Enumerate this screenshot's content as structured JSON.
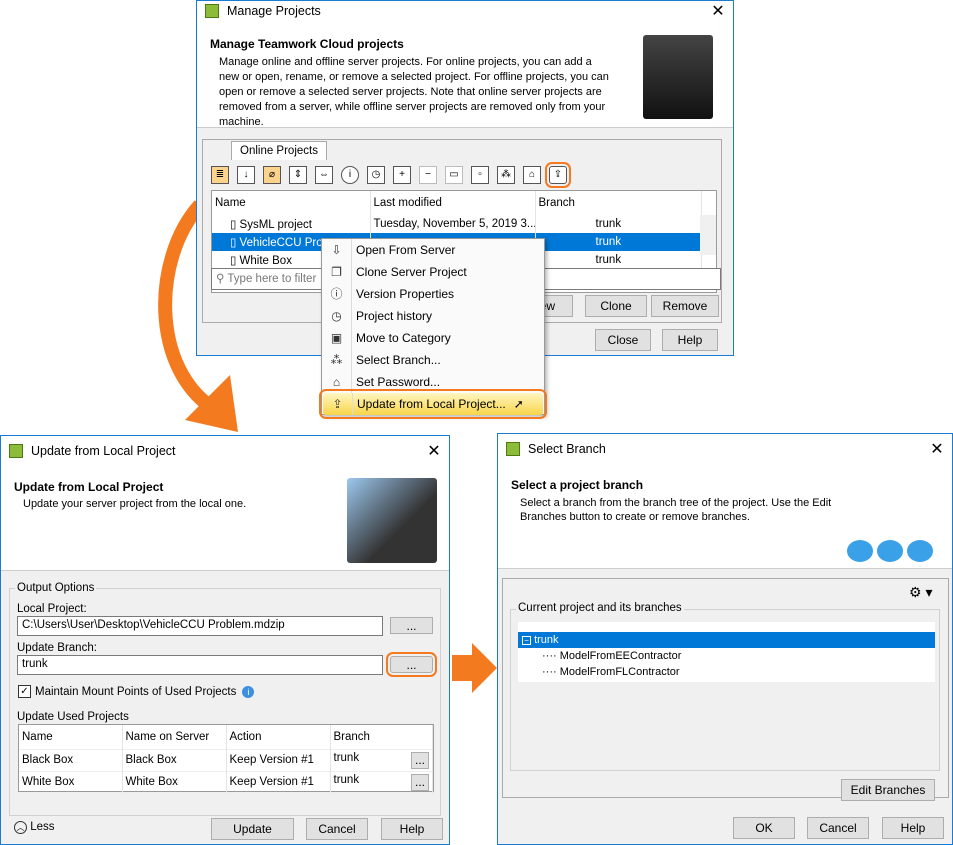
{
  "manage": {
    "title": "Manage Projects",
    "heading": "Manage Teamwork Cloud projects",
    "description": "Manage online and offline server projects. For online projects, you can add a new or open, rename, or remove a selected project. For offline projects, you can open or remove a selected server projects. Note that online server projects are removed from a server, while offline server projects are removed only from your machine.",
    "tab": "Online Projects",
    "columns": [
      "Name",
      "Last modified",
      "Branch"
    ],
    "sort_index": "1",
    "rows": [
      {
        "name": "SysML project",
        "modified": "Tuesday, November 5, 2019 3...",
        "branch": "trunk"
      },
      {
        "name": "VehicleCCU Pro...",
        "modified": "",
        "branch": "trunk"
      },
      {
        "name": "White Box",
        "modified": "",
        "branch": "trunk"
      }
    ],
    "filter_placeholder": "Type here to filter",
    "buttons": {
      "new": "New",
      "clone": "Clone",
      "remove": "Remove",
      "close": "Close",
      "help": "Help"
    },
    "ellipsis": "..."
  },
  "context_menu": [
    "Open From Server",
    "Clone Server Project",
    "Version Properties",
    "Project history",
    "Move to Category",
    "Select Branch...",
    "Set Password...",
    "Update from Local Project..."
  ],
  "update": {
    "title": "Update from Local Project",
    "heading": "Update from Local Project",
    "description": "Update your server project from the local one.",
    "group": "Output Options",
    "local_label": "Local Project:",
    "local_value": "C:\\Users\\User\\Desktop\\VehicleCCU Problem.mdzip",
    "branch_label": "Update Branch:",
    "branch_value": "trunk",
    "maintain": "Maintain Mount Points of Used Projects",
    "used_label": "Update Used Projects",
    "columns": [
      "Name",
      "Name on Server",
      "Action",
      "Branch"
    ],
    "rows": [
      {
        "name": "Black Box",
        "server": "Black Box",
        "action": "Keep Version #1",
        "branch": "trunk"
      },
      {
        "name": "White Box",
        "server": "White Box",
        "action": "Keep Version #1",
        "branch": "trunk"
      }
    ],
    "less": "Less",
    "buttons": {
      "update": "Update",
      "cancel": "Cancel",
      "help": "Help"
    }
  },
  "select": {
    "title": "Select Branch",
    "heading": "Select a project branch",
    "description": "Select a branch from the branch tree of the project. Use the Edit Branches button to create or remove branches.",
    "group": "Current project and its branches",
    "tree": {
      "root": "trunk",
      "children": [
        "ModelFromEEContractor",
        "ModelFromFLContractor"
      ]
    },
    "buttons": {
      "edit": "Edit Branches",
      "ok": "OK",
      "cancel": "Cancel",
      "help": "Help"
    }
  },
  "colors": {
    "accent": "#f47a20",
    "selection": "#0078d7"
  }
}
